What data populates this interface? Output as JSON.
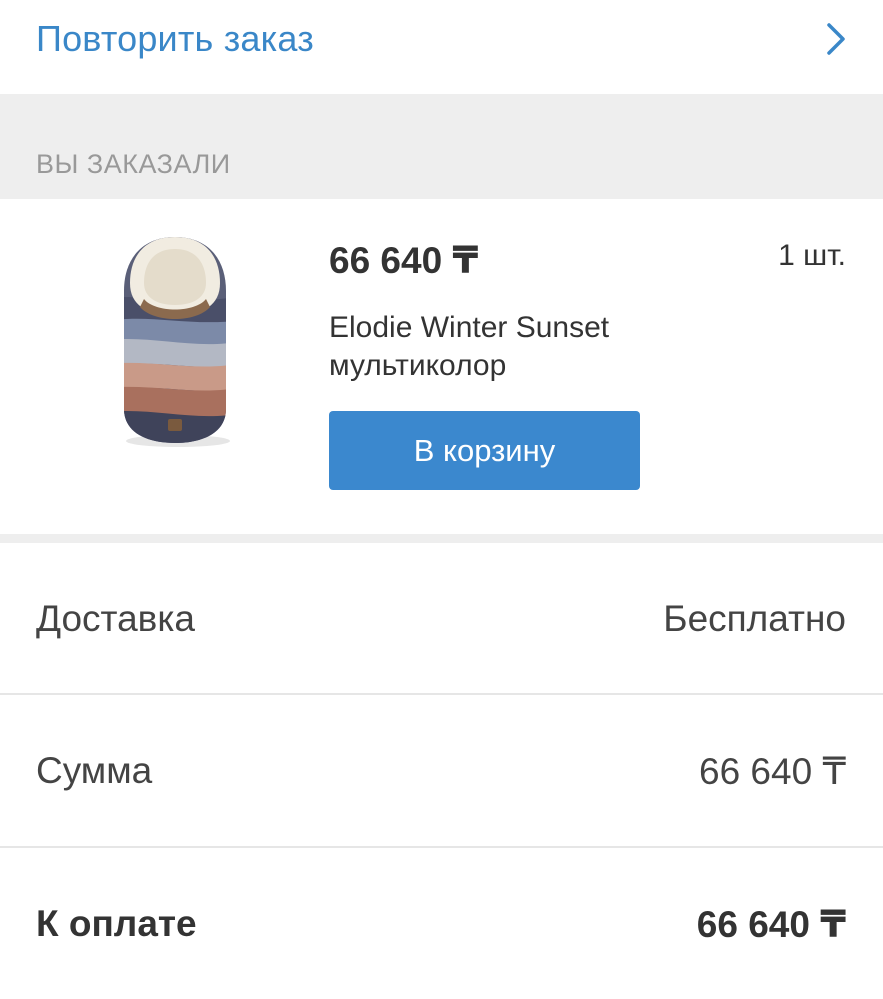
{
  "repeat_order": {
    "label": "Повторить заказ",
    "icon": "chevron-right-icon"
  },
  "ordered_section": {
    "title": "ВЫ ЗАКАЗАЛИ"
  },
  "product": {
    "price": "66 640 ₸",
    "quantity": "1 шт.",
    "name": "Elodie Winter Sunset мультиколор",
    "cart_button_label": "В корзину"
  },
  "summary": {
    "delivery_label": "Доставка",
    "delivery_value": "Бесплатно",
    "sum_label": "Сумма",
    "sum_value": "66 640 ₸",
    "to_pay_label": "К оплате",
    "to_pay_value": "66 640 ₸"
  },
  "colors": {
    "accent": "#3a87c8",
    "button": "#3b88ce",
    "section_bg": "#eeeeee"
  }
}
